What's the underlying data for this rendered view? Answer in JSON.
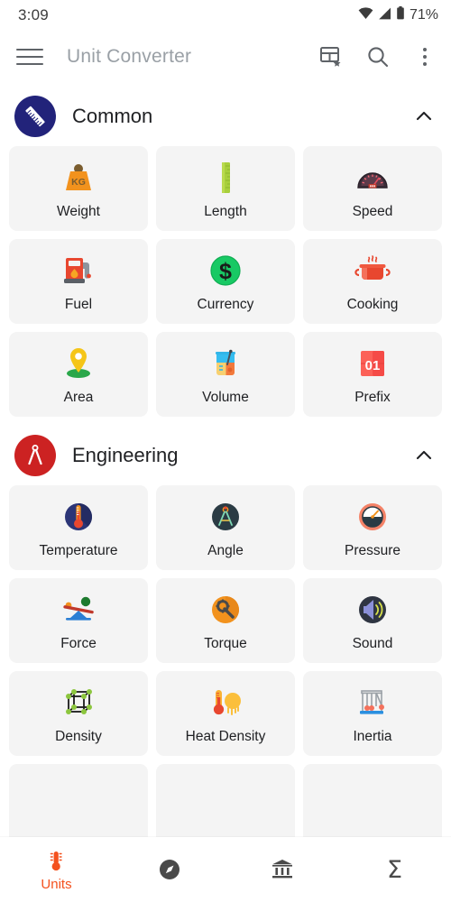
{
  "status_bar": {
    "time": "3:09",
    "battery": "71%",
    "icons": [
      "wifi-icon",
      "cellular-signal-icon",
      "battery-icon"
    ]
  },
  "app_bar": {
    "title": "Unit Converter",
    "menu_icon": "hamburger-menu-icon",
    "actions": [
      {
        "name": "favorites-grid-icon",
        "label": "Favorites grid"
      },
      {
        "name": "search-icon",
        "label": "Search"
      },
      {
        "name": "overflow-menu-icon",
        "label": "More options"
      }
    ]
  },
  "colors": {
    "accent": "#f4511e",
    "common_badge": "#22237a",
    "engineering_badge": "#cc2222",
    "card_bg": "#f4f4f4",
    "title_gray": "#9aa0a6"
  },
  "sections": [
    {
      "title": "Common",
      "badge_icon": "ruler-icon",
      "badge_color": "#22237a",
      "expanded": true,
      "chevron": "chevron-up-icon",
      "items": [
        {
          "label": "Weight",
          "icon": "weight-kg-icon"
        },
        {
          "label": "Length",
          "icon": "ruler-green-icon"
        },
        {
          "label": "Speed",
          "icon": "speedometer-icon"
        },
        {
          "label": "Fuel",
          "icon": "fuel-pump-icon"
        },
        {
          "label": "Currency",
          "icon": "dollar-coin-icon"
        },
        {
          "label": "Cooking",
          "icon": "cooking-pot-icon"
        },
        {
          "label": "Area",
          "icon": "map-pin-icon"
        },
        {
          "label": "Volume",
          "icon": "beaker-icon"
        },
        {
          "label": "Prefix",
          "icon": "counter-01-icon",
          "icon_text": "01"
        }
      ]
    },
    {
      "title": "Engineering",
      "badge_icon": "compass-divider-icon",
      "badge_color": "#cc2222",
      "expanded": true,
      "chevron": "chevron-up-icon",
      "items": [
        {
          "label": "Temperature",
          "icon": "thermometer-circle-icon"
        },
        {
          "label": "Angle",
          "icon": "compass-circle-icon"
        },
        {
          "label": "Pressure",
          "icon": "pressure-gauge-icon"
        },
        {
          "label": "Force",
          "icon": "seesaw-icon"
        },
        {
          "label": "Torque",
          "icon": "wrench-gear-icon"
        },
        {
          "label": "Sound",
          "icon": "speaker-icon"
        },
        {
          "label": "Density",
          "icon": "cube-lattice-icon"
        },
        {
          "label": "Heat Density",
          "icon": "thermometer-sun-icon"
        },
        {
          "label": "Inertia",
          "icon": "newtons-cradle-icon"
        }
      ]
    }
  ],
  "bottom_nav": {
    "items": [
      {
        "label": "Units",
        "icon": "thermometer-units-icon",
        "active": true
      },
      {
        "label": "",
        "icon": "compass-icon",
        "active": false
      },
      {
        "label": "",
        "icon": "bank-icon",
        "active": false
      },
      {
        "label": "",
        "icon": "sigma-icon",
        "active": false,
        "glyph": "Σ"
      }
    ]
  }
}
